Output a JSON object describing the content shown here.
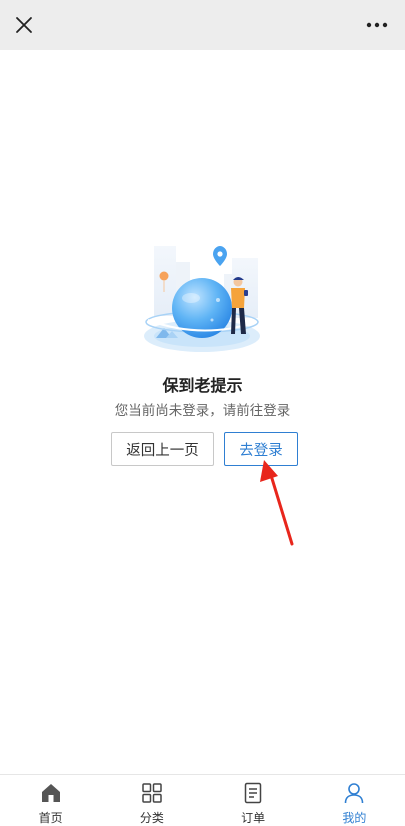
{
  "topbar": {
    "close_icon": "close-icon",
    "more_icon": "more-dots-icon"
  },
  "notice": {
    "title": "保到老提示",
    "subtitle": "您当前尚未登录，请前往登录",
    "back_label": "返回上一页",
    "login_label": "去登录"
  },
  "tabbar": {
    "items": [
      {
        "label": "首页",
        "icon": "home-icon",
        "active": false
      },
      {
        "label": "分类",
        "icon": "category-grid-icon",
        "active": false
      },
      {
        "label": "订单",
        "icon": "order-document-icon",
        "active": false
      },
      {
        "label": "我的",
        "icon": "user-icon",
        "active": true
      }
    ]
  },
  "colors": {
    "accent": "#2f7fd2",
    "topbar_bg": "#ededed",
    "annotation_arrow": "#e8261c"
  }
}
